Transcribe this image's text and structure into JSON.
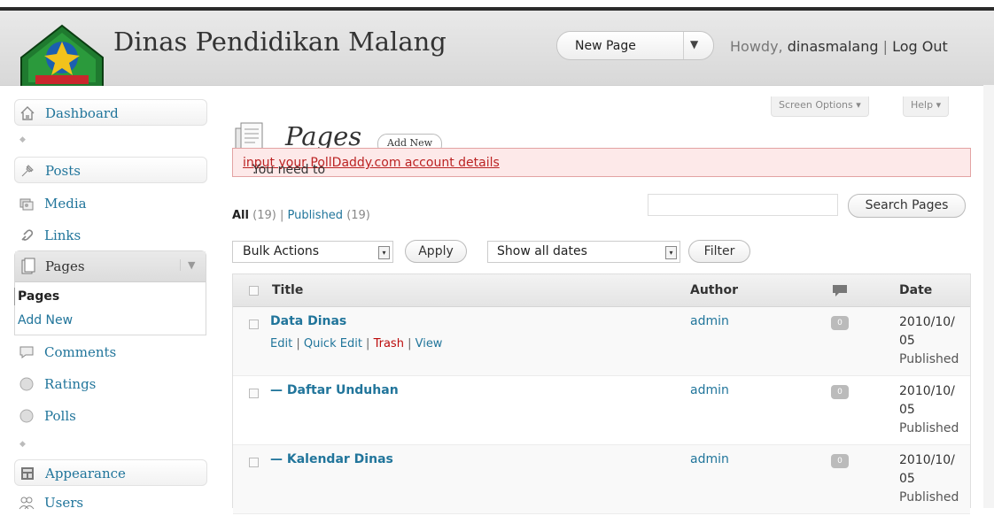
{
  "header": {
    "site_title": "Dinas Pendidikan Malang",
    "favorite_action": "New Page",
    "favorite_arrow": "▼",
    "howdy_prefix": "Howdy, ",
    "username": "dinasmalang",
    "separator": " | ",
    "logout": "Log Out"
  },
  "screen_options": "Screen Options ▾",
  "help": "Help ▾",
  "sidebar": {
    "dashboard": "Dashboard",
    "posts": "Posts",
    "media": "Media",
    "links": "Links",
    "pages": "Pages",
    "pages_sub": [
      "Pages",
      "Add New"
    ],
    "comments": "Comments",
    "ratings": "Ratings",
    "polls": "Polls",
    "appearance": "Appearance",
    "users": "Users"
  },
  "main": {
    "title": "Pages",
    "add_new": "Add New",
    "notice_prefix": "You need to ",
    "notice_link": "input your PollDaddy.com account details",
    "notice_suffix": ".",
    "filter_all": "All",
    "filter_all_count": " (19)",
    "filter_sep": " | ",
    "filter_published": "Published",
    "filter_published_count": " (19)",
    "search_button": "Search Pages",
    "bulk_actions": "Bulk Actions",
    "apply": "Apply",
    "dates": "Show all dates",
    "filter": "Filter"
  },
  "table": {
    "columns": [
      "Title",
      "Author",
      "Date"
    ],
    "rows": [
      {
        "title": "Data Dinas",
        "actions": [
          "Edit",
          "Quick Edit",
          "Trash",
          "View"
        ],
        "author": "admin",
        "comments": "0",
        "date": "2010/10/",
        "date2": "05",
        "status": "Published"
      },
      {
        "title": "— Daftar Unduhan",
        "author": "admin",
        "comments": "0",
        "date": "2010/10/",
        "date2": "05",
        "status": "Published"
      },
      {
        "title": "— Kalendar Dinas",
        "author": "admin",
        "comments": "0",
        "date": "2010/10/",
        "date2": "05",
        "status": "Published"
      }
    ]
  }
}
